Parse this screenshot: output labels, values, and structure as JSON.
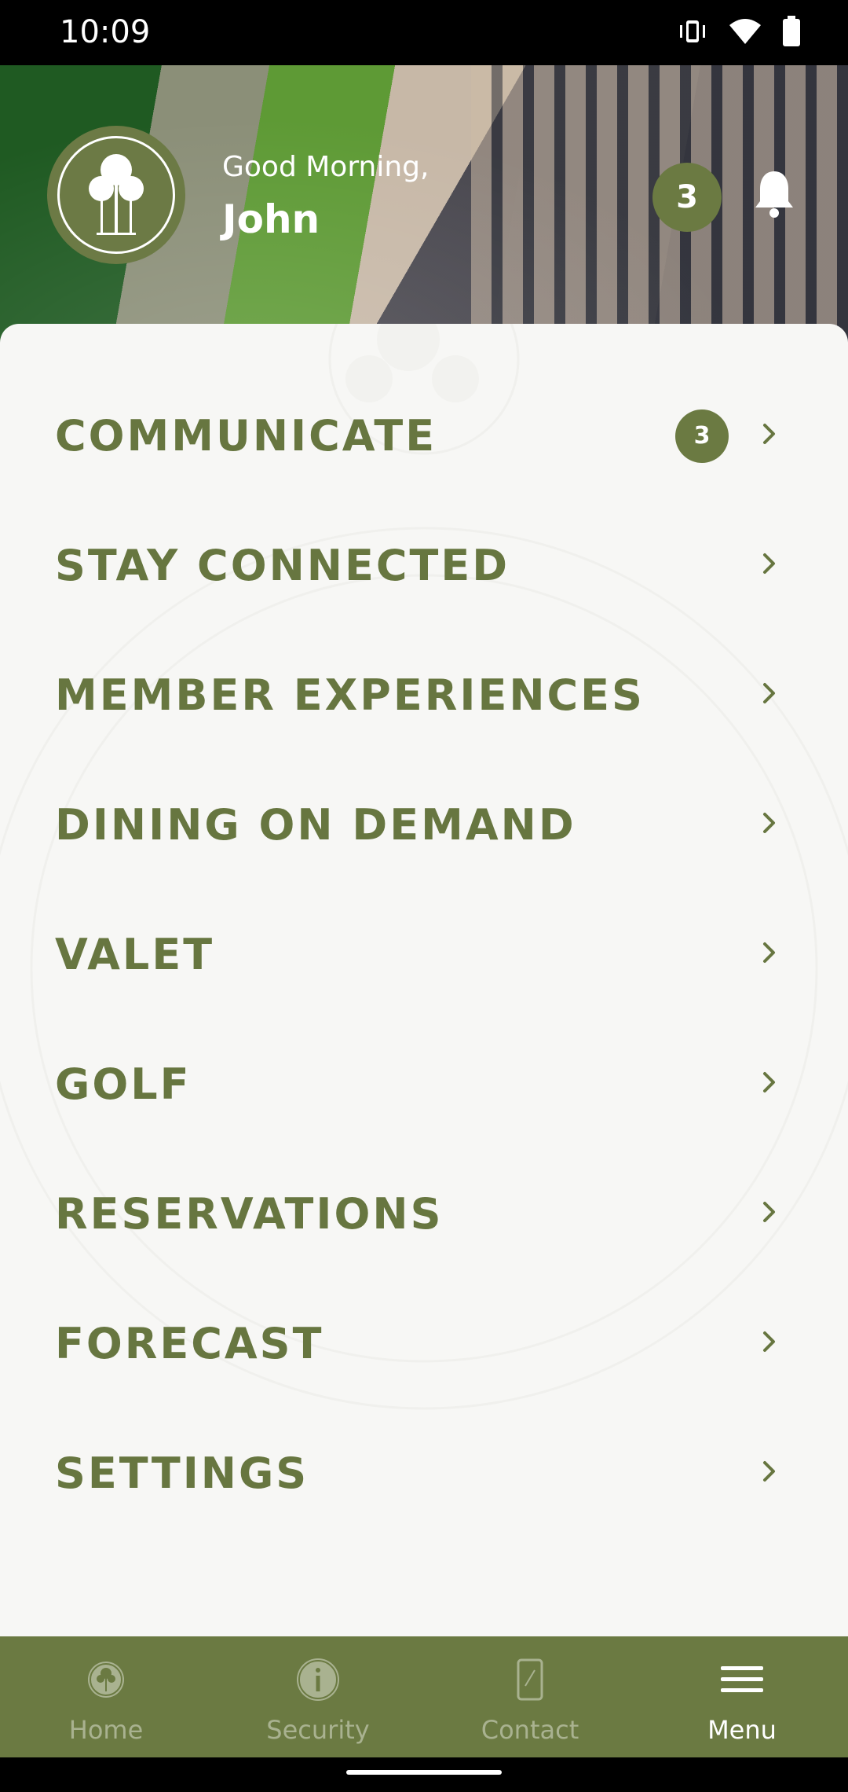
{
  "status_bar": {
    "time": "10:09",
    "icons": [
      "vibrate-icon",
      "wifi-icon",
      "battery-icon"
    ]
  },
  "header": {
    "greeting": "Good Morning,",
    "user_name": "John",
    "notification_count": "3"
  },
  "menu": {
    "items": [
      {
        "label": "COMMUNICATE",
        "badge": "3"
      },
      {
        "label": "STAY CONNECTED"
      },
      {
        "label": "MEMBER EXPERIENCES"
      },
      {
        "label": "DINING ON DEMAND"
      },
      {
        "label": "VALET"
      },
      {
        "label": "GOLF"
      },
      {
        "label": "RESERVATIONS"
      },
      {
        "label": "FORECAST"
      },
      {
        "label": "SETTINGS"
      }
    ]
  },
  "bottom_nav": {
    "items": [
      {
        "label": "Home",
        "icon": "tree-logo-icon"
      },
      {
        "label": "Security",
        "icon": "info-icon"
      },
      {
        "label": "Contact",
        "icon": "phone-icon"
      },
      {
        "label": "Menu",
        "icon": "hamburger-menu-icon",
        "active": true
      }
    ]
  },
  "colors": {
    "brand_green": "#6b7a42",
    "menu_text": "#677640",
    "panel_bg": "#f7f7f5",
    "nav_inactive": "#a9b290",
    "nav_active": "#ffffff"
  }
}
